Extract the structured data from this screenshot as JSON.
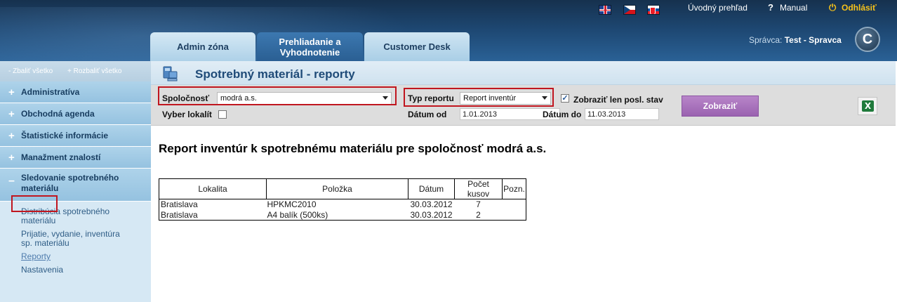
{
  "header": {
    "languages": [
      "en",
      "cz",
      "sk"
    ],
    "overview_link": "Úvodný prehľad",
    "manual_link": "Manual",
    "logout_link": "Odhlásiť",
    "help_icon": "?",
    "power_icon": "⏻",
    "user_prefix": "Správca: ",
    "user_name": "Test - Spravca",
    "logo_letter": "C",
    "tabs": [
      {
        "label": "Admin zóna"
      },
      {
        "label": "Prehliadanie a Vyhodnotenie"
      },
      {
        "label": "Customer Desk"
      }
    ]
  },
  "sidebar": {
    "collapse_all": "- Zbaliť všetko",
    "expand_all": "+ Rozbaliť všetko",
    "items": [
      {
        "label": "Administratíva",
        "marker": "+"
      },
      {
        "label": "Obchodná agenda",
        "marker": "+"
      },
      {
        "label": "Štatistické informácie",
        "marker": "+"
      },
      {
        "label": "Manažment znalostí",
        "marker": "+"
      },
      {
        "label": "Sledovanie spotrebného materiálu",
        "marker": "–"
      }
    ],
    "subitems": [
      {
        "label": "Distribúcia spotrebného materiálu"
      },
      {
        "label": "Prijatie, vydanie, inventúra sp. materiálu"
      },
      {
        "label": "Reporty"
      },
      {
        "label": "Nastavenia"
      }
    ]
  },
  "page": {
    "title": "Spotrebný materiál - reporty"
  },
  "filter": {
    "company_label": "Spoločnosť",
    "company_value": "modrá a.s.",
    "locality_label": "Vyber lokalít",
    "report_type_label": "Typ reportu",
    "report_type_value": "Report inventúr",
    "last_state_label": "Zobraziť len posl. stav",
    "last_state_checked": "✓",
    "date_from_label": "Dátum od",
    "date_from_value": "1.01.2013",
    "date_to_label": "Dátum do",
    "date_to_value": "11.03.2013",
    "show_button": "Zobraziť",
    "excel_icon": "X"
  },
  "report": {
    "title": "Report inventúr k spotrebnému materiálu pre spoločnosť modrá a.s.",
    "columns": [
      "Lokalita",
      "Položka",
      "Dátum",
      "Počet kusov",
      "Pozn."
    ],
    "rows": [
      [
        "Bratislava",
        "HPKMC2010",
        "30.03.2012",
        "7",
        ""
      ],
      [
        "Bratislava",
        "A4 balík (500ks)",
        "30.03.2012",
        "2",
        ""
      ]
    ]
  }
}
